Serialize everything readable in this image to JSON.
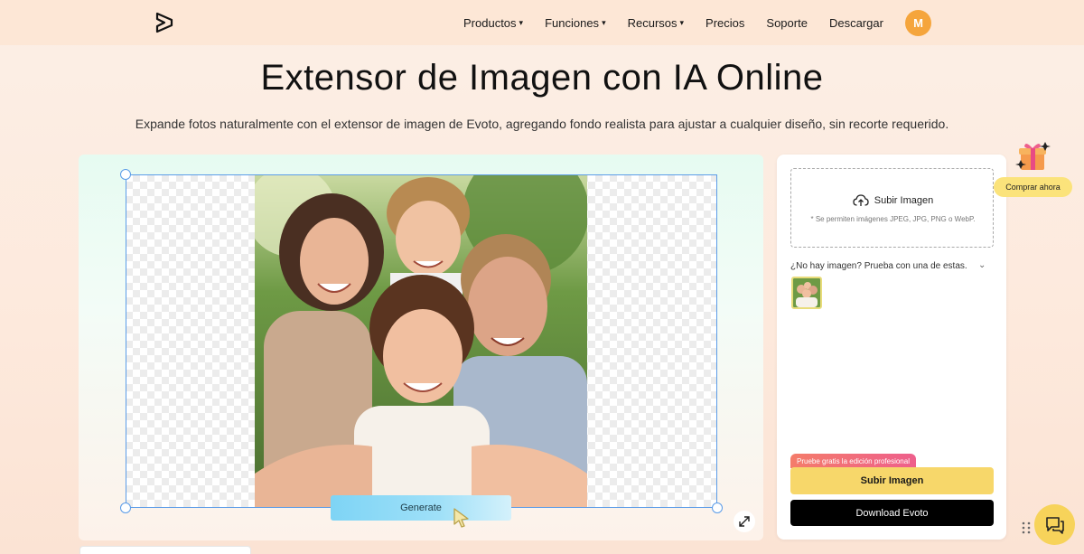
{
  "header": {
    "nav": [
      {
        "label": "Productos",
        "has_caret": true
      },
      {
        "label": "Funciones",
        "has_caret": true
      },
      {
        "label": "Recursos",
        "has_caret": true
      },
      {
        "label": "Precios",
        "has_caret": false
      },
      {
        "label": "Soporte",
        "has_caret": false
      },
      {
        "label": "Descargar",
        "has_caret": false
      }
    ],
    "avatar_initial": "M",
    "logo_icon": "evoto-logo-icon",
    "caret": "▾"
  },
  "hero": {
    "title": "Extensor de Imagen con IA Online",
    "subtitle": "Expande fotos naturalmente con el extensor de imagen de Evoto, agregando fondo realista para ajustar a cualquier diseño, sin recorte requerido."
  },
  "editor": {
    "generate_label": "Generate",
    "expand_icon": "expand-diagonal-icon"
  },
  "upload_panel": {
    "upload_label": "Subir Imagen",
    "upload_hint": "* Se permiten imágenes JPEG, JPG, PNG o WebP.",
    "samples_title": "¿No hay imagen? Prueba con una de estas.",
    "samples_chevron": "⌄",
    "pro_badge": "Pruebe gratis la edición profesional",
    "upload_button": "Subir Imagen",
    "download_button": "Download Evoto"
  },
  "floating": {
    "buy_label": "Comprar ahora",
    "chat_icon": "chat-bubbles-icon"
  },
  "colors": {
    "accent_yellow": "#f7d76a",
    "avatar_orange": "#f5a53c",
    "frame_blue": "#5b9ce8",
    "generate_cyan": "#7ed4f5"
  }
}
